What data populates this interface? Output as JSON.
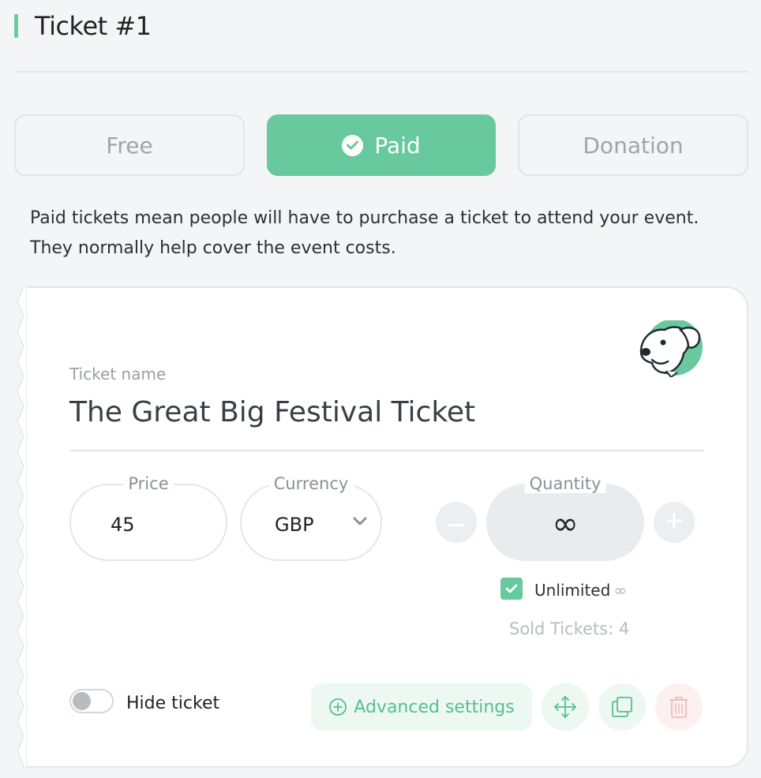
{
  "header": {
    "title": "Ticket #1"
  },
  "ticket_types": {
    "free": "Free",
    "paid": "Paid",
    "donation": "Donation",
    "selected": "Paid"
  },
  "description": {
    "line1": "Paid tickets mean people will have to purchase a ticket to attend your event.",
    "line2": "They normally help cover the event costs."
  },
  "ticket": {
    "name_label": "Ticket name",
    "name": "The Great Big Festival Ticket",
    "price_label": "Price",
    "price": "45",
    "currency_label": "Currency",
    "currency": "GBP",
    "quantity_label": "Quantity",
    "quantity": "∞",
    "unlimited_label": "Unlimited",
    "unlimited_symbol": "∞",
    "unlimited_checked": true,
    "sold_tickets": "Sold Tickets: 4",
    "hide_label": "Hide ticket",
    "hide_enabled": false,
    "advanced_label": "Advanced settings"
  },
  "icons": {
    "selected_check": "check-circle-icon",
    "currency_dropdown": "chevron-down-icon",
    "decrease": "minus-icon",
    "increase": "plus-icon",
    "advanced": "plus-circle-icon",
    "move": "move-icon",
    "duplicate": "copy-icon",
    "delete": "trash-icon",
    "mascot": "dog-mascot-icon"
  },
  "colors": {
    "accent": "#67c99d",
    "accent_light": "#edf8f2",
    "danger_light": "#fdf0f0",
    "danger": "#f2b8b8",
    "background": "#f4f5f7"
  }
}
